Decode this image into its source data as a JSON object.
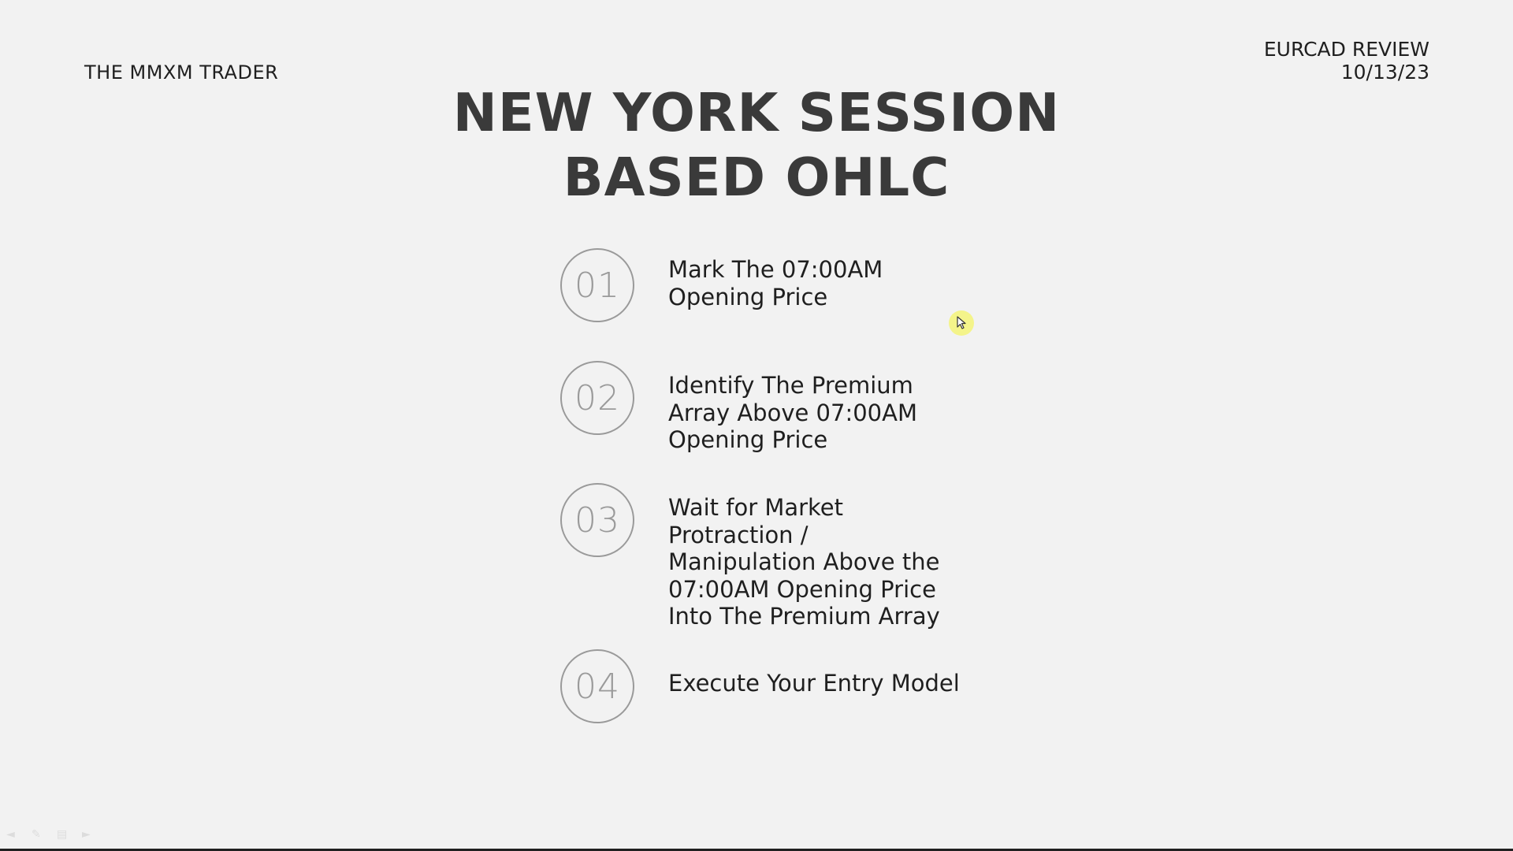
{
  "header": {
    "brand": "THE MMXM TRADER",
    "review_title": "EURCAD REVIEW",
    "review_date": "10/13/23"
  },
  "title": {
    "line1": "NEW YORK SESSION",
    "line2": "BASED OHLC"
  },
  "steps": [
    {
      "number": "01",
      "text": "Mark The 07:00AM\nOpening Price"
    },
    {
      "number": "02",
      "text": "Identify The Premium\nArray Above 07:00AM\nOpening Price"
    },
    {
      "number": "03",
      "text": "Wait for Market\nProtraction /\nManipulation Above the\n07:00AM Opening Price\nInto The Premium Array"
    },
    {
      "number": "04",
      "text": "Execute Your Entry Model"
    }
  ],
  "toolbar": {
    "icons": [
      "back-arrow-icon",
      "pen-icon",
      "slides-icon",
      "forward-arrow-icon"
    ]
  },
  "colors": {
    "background": "#f2f2f2",
    "title": "#3a3a3a",
    "circle": "#9a9a9a",
    "cursor_highlight": "#f5f578"
  }
}
